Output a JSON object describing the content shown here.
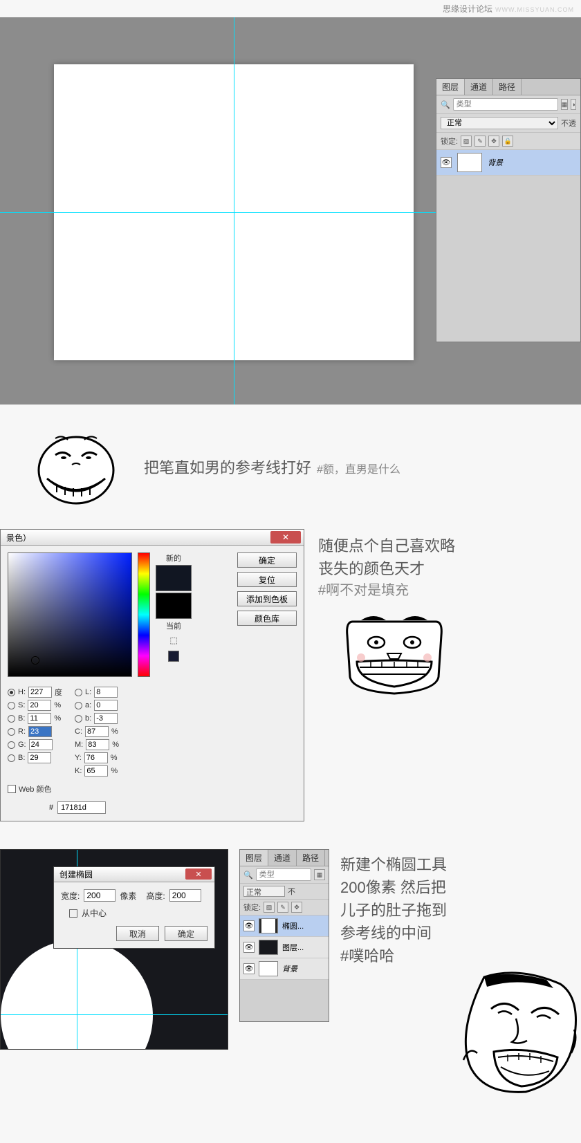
{
  "watermark": {
    "site": "思缘设计论坛",
    "url": "WWW.MISSYUAN.COM"
  },
  "panel": {
    "tabs": [
      "图层",
      "通道",
      "路径"
    ],
    "search_placeholder": "类型",
    "blend_mode": "正常",
    "opacity_label": "不透",
    "lock_label": "锁定:",
    "bg_layer": "背景"
  },
  "comment1": {
    "main": "把笔直如男的参考线打好",
    "hash": "#额，直男是什么"
  },
  "picker": {
    "title": "景色）",
    "new_label": "新的",
    "current_label": "当前",
    "btn_ok": "确定",
    "btn_reset": "复位",
    "btn_add": "添加到色板",
    "btn_lib": "颜色库",
    "H": "227",
    "H_unit": "度",
    "S": "20",
    "S_unit": "%",
    "B": "11",
    "B_unit": "%",
    "R": "23",
    "G": "24",
    "Bv": "29",
    "L": "8",
    "a": "0",
    "b": "-3",
    "C": "87",
    "M": "83",
    "Y": "76",
    "K": "65",
    "pct": "%",
    "hex": "17181d",
    "web_label": "Web 颜色"
  },
  "comment2": {
    "line1": "随便点个自己喜欢略",
    "line2": "丧失的颜色天才",
    "hash": "#啊不对是填充"
  },
  "ellipse": {
    "title": "创建椭圆",
    "width_label": "宽度:",
    "width_value": "200",
    "width_unit": "像素",
    "height_label": "高度:",
    "height_value": "200",
    "center_label": "从中心",
    "cancel": "取消",
    "ok": "确定"
  },
  "panel2": {
    "tabs": [
      "图层",
      "通道",
      "路径"
    ],
    "search": "类型",
    "blend": "正常",
    "opacity_label": "不",
    "lock": "锁定:",
    "ellipse_layer": "椭圆...",
    "shape_layer": "图层...",
    "bg_layer": "背景"
  },
  "comment3": {
    "line1": "新建个椭圆工具",
    "line2": "200像素 然后把",
    "line3": "儿子的肚子拖到",
    "line4": "参考线的中间",
    "hash": "#噗哈哈"
  }
}
